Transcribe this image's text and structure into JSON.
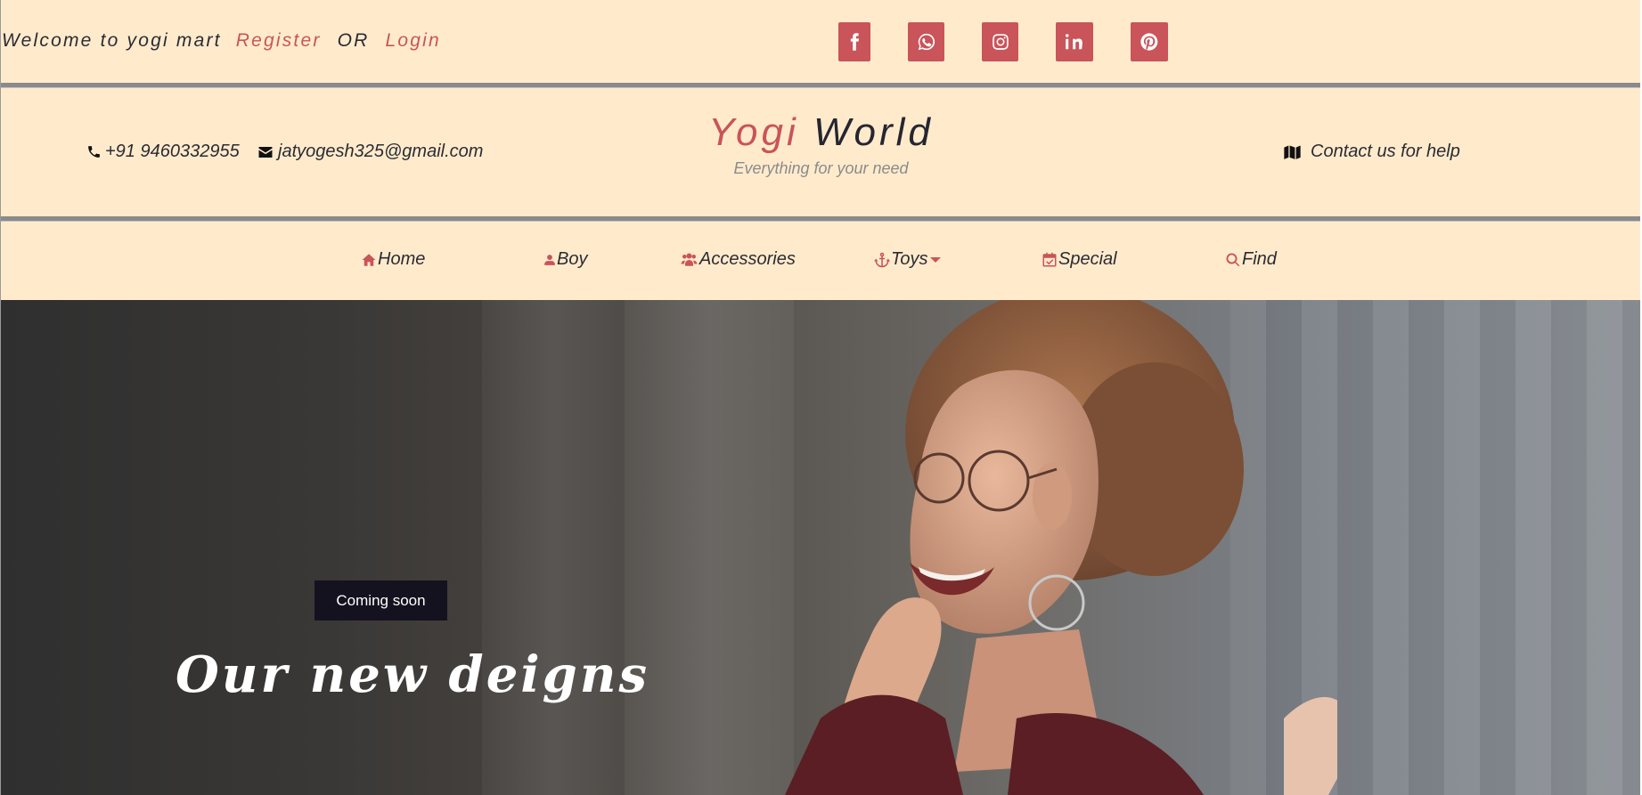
{
  "topbar": {
    "welcome_text": "Welcome to yogi mart",
    "register_label": "Register",
    "or_text": "OR",
    "login_label": "Login",
    "social": [
      "facebook-icon",
      "whatsapp-icon",
      "instagram-icon",
      "linkedin-icon",
      "pinterest-icon"
    ]
  },
  "header": {
    "phone": "+91 9460332955",
    "email": "jatyogesh325@gmail.com",
    "brand_first": "Yogi",
    "brand_second": "World",
    "tagline": "Everything for your need",
    "help_text": "Contact us for help"
  },
  "nav": {
    "items": [
      {
        "label": "Home",
        "icon": "home-icon"
      },
      {
        "label": "Boy",
        "icon": "user-icon"
      },
      {
        "label": "Accessories",
        "icon": "users-icon"
      },
      {
        "label": "Toys",
        "icon": "anchor-icon"
      },
      {
        "label": "Special",
        "icon": "calendar-check-icon"
      },
      {
        "label": "Find",
        "icon": "search-icon"
      }
    ]
  },
  "hero": {
    "badge": "Coming soon",
    "title": "Our new deigns"
  },
  "colors": {
    "accent": "#c9545a",
    "cream": "#ffebcc",
    "dark": "#15121f"
  }
}
